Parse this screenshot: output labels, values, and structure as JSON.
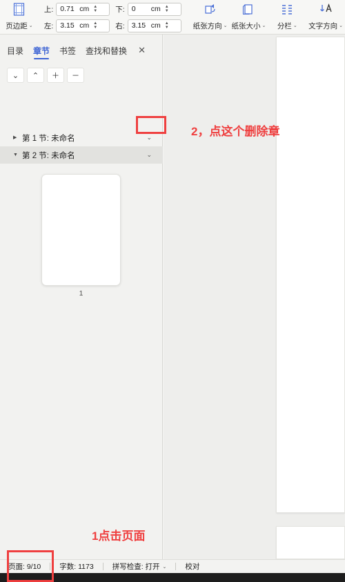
{
  "ribbon": {
    "margin_icon_name": "page-margins-icon",
    "margin_label": "页边距",
    "fields": [
      {
        "label": "上:",
        "value": "0.71",
        "unit": "cm"
      },
      {
        "label": "下:",
        "value": "0",
        "unit": "cm"
      },
      {
        "label": "左:",
        "value": "3.15",
        "unit": "cm"
      },
      {
        "label": "右:",
        "value": "3.15",
        "unit": "cm"
      }
    ],
    "commands": [
      {
        "label": "纸张方向",
        "icon": "page-orientation-icon"
      },
      {
        "label": "纸张大小",
        "icon": "page-size-icon"
      },
      {
        "label": "分栏",
        "icon": "columns-icon"
      },
      {
        "label": "文字方向",
        "icon": "text-direction-icon"
      }
    ],
    "caret": "⌄"
  },
  "nav_panel": {
    "tabs": [
      {
        "label": "目录",
        "active": false
      },
      {
        "label": "章节",
        "active": true
      },
      {
        "label": "书签",
        "active": false
      },
      {
        "label": "查找和替换",
        "active": false
      }
    ],
    "close_icon": "✕",
    "toolbar_buttons": [
      {
        "icon": "chevron-down-icon",
        "glyph": "⌄"
      },
      {
        "icon": "chevron-up-icon",
        "glyph": "⌃"
      },
      {
        "icon": "plus-icon",
        "glyph": "＋"
      },
      {
        "icon": "minus-icon",
        "glyph": "－"
      }
    ],
    "tree": [
      {
        "label": "第 1 节: 未命名",
        "expanded": false,
        "triangle": "▶",
        "chevron": "⌄",
        "selected": false
      },
      {
        "label": "第 2 节: 未命名",
        "expanded": true,
        "triangle": "▼",
        "chevron": "⌄",
        "selected": true
      }
    ],
    "thumbnail_label": "1"
  },
  "status_bar": {
    "page_label": "页面: 9/10",
    "word_count_label": "字数: 1173",
    "spellcheck_label": "拼写检查: 打开",
    "spellcheck_caret": "⌄",
    "proofread_label": "校对"
  },
  "annotations": {
    "step2_text": "2，点这个删除章",
    "step1_text": "1点击页面",
    "color": "#ef3f3f"
  }
}
